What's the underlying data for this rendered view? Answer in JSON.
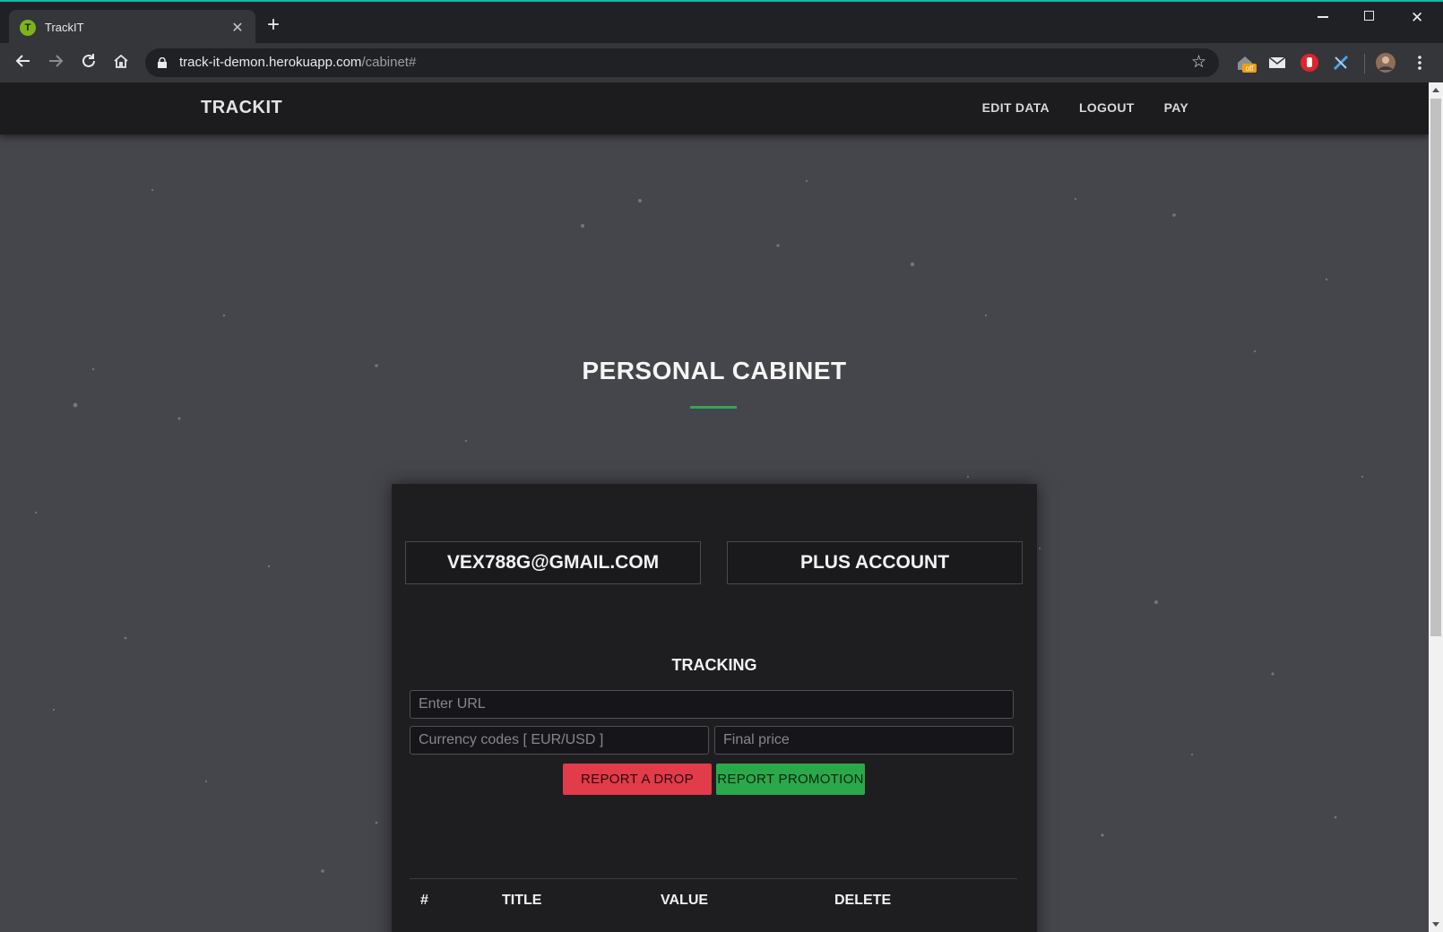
{
  "browser": {
    "tab_title": "TrackIT",
    "tab_favicon_letter": "T",
    "url_host": "track-it-demon.herokuapp.com",
    "url_path": "/cabinet#",
    "new_tab_glyph": "+",
    "extension_badge": "off"
  },
  "navbar": {
    "brand": "TRACKIT",
    "links": [
      "EDIT DATA",
      "LOGOUT",
      "PAY"
    ]
  },
  "page": {
    "heading": "PERSONAL CABINET",
    "accent_color": "#2fa84f"
  },
  "account": {
    "email": "VEX788G@GMAIL.COM",
    "plan": "PLUS ACCOUNT"
  },
  "tracking": {
    "title": "TRACKING",
    "url_placeholder": "Enter URL",
    "currency_placeholder": "Currency codes [ EUR/USD ]",
    "price_placeholder": "Final price",
    "report_drop_label": "REPORT A DROP",
    "report_promotion_label": "REPORT PROMOTION",
    "drop_color": "#e23b4a",
    "promotion_color": "#2aa84a"
  },
  "table": {
    "headers": [
      "#",
      "TITLE",
      "VALUE",
      "DELETE"
    ]
  }
}
